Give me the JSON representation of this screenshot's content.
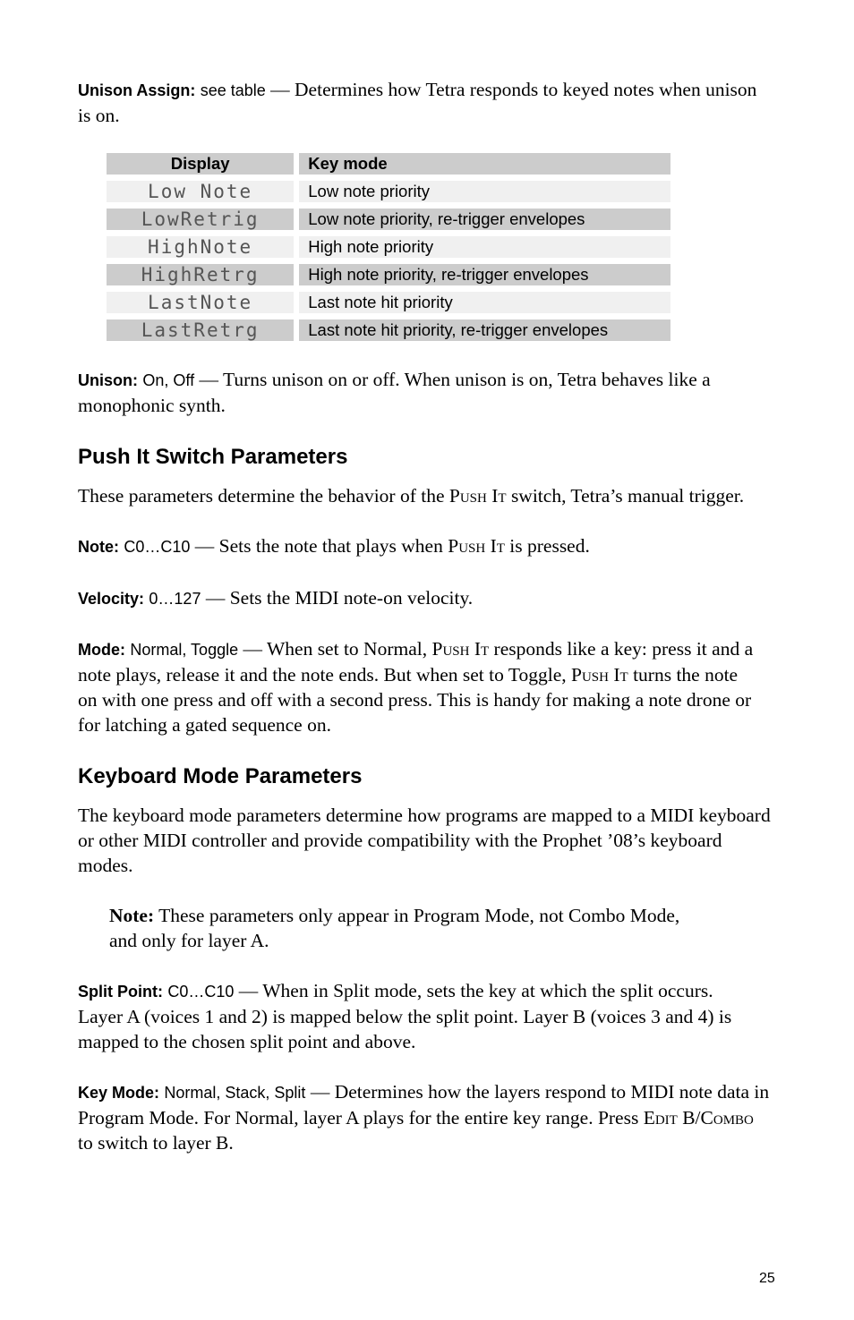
{
  "unison_assign": {
    "label": "Unison Assign:",
    "values": "see table",
    "dash": " — ",
    "desc": "Determines how Tetra responds to keyed notes when unison is on."
  },
  "table": {
    "headers": [
      "Display",
      "Key mode"
    ],
    "rows": [
      {
        "display": "Low Note",
        "mode": "Low note priority"
      },
      {
        "display": "LowRetrig",
        "mode": "Low note priority, re-trigger envelopes"
      },
      {
        "display": "HighNote",
        "mode": "High note priority"
      },
      {
        "display": "HighRetrg",
        "mode": "High note priority, re-trigger envelopes"
      },
      {
        "display": "LastNote",
        "mode": "Last note hit priority"
      },
      {
        "display": "LastRetrg",
        "mode": "Last note hit priority, re-trigger envelopes"
      }
    ]
  },
  "unison": {
    "label": "Unison:",
    "values": "On, Off",
    "dash": " — ",
    "desc": "Turns unison on or off. When unison is on, Tetra behaves like a monophonic synth."
  },
  "push_it_section": {
    "heading": "Push It Switch Parameters",
    "intro_pre": "These parameters determine the behavior of the ",
    "intro_sc": "Push It",
    "intro_post": " switch, Tetra’s manual trigger.",
    "note": {
      "label": "Note:",
      "values": "C0…C10",
      "dash": " — ",
      "desc_pre": "Sets the note that plays when ",
      "desc_sc": "Push It",
      "desc_post": " is pressed."
    },
    "velocity": {
      "label": "Velocity:",
      "values": "0…127",
      "dash": " — ",
      "desc": "Sets the MIDI note-on velocity."
    },
    "mode": {
      "label": "Mode:",
      "values": "Normal, Toggle",
      "dash": " — ",
      "desc_1": "When set to Normal, ",
      "sc_1": "Push It",
      "desc_2": " responds like a key: press it and a note plays, release it and the note ends. But when set to Toggle, ",
      "sc_2": "Push It",
      "desc_3": " turns the note on with one press and off with a second press. This is handy for making a note drone or for latching a gated sequence on."
    }
  },
  "keyboard_section": {
    "heading": "Keyboard Mode Parameters",
    "intro": "The keyboard mode parameters determine how programs are mapped to a MIDI keyboard or other MIDI controller and provide compatibility with the Prophet ’08’s keyboard modes.",
    "note_label": "Note:",
    "note_text": " These parameters only appear in Program Mode, not Combo Mode, and only for layer A.",
    "split_point": {
      "label": "Split Point:",
      "values": "C0…C10",
      "dash": " — ",
      "desc": "When in Split mode, sets the key at which the split occurs. Layer A (voices 1 and 2) is mapped below the split point. Layer B (voices 3 and 4) is mapped to the chosen split point and above."
    },
    "key_mode": {
      "label": "Key Mode:",
      "values": "Normal, Stack, Split",
      "dash": " — ",
      "desc_1": "Determines how the layers respond to MIDI note data in Program Mode. For Normal, layer A plays for the entire key range. Press ",
      "sc_1": "Edit B/Combo",
      "desc_2": " to switch to layer B."
    }
  },
  "page_number": "25"
}
